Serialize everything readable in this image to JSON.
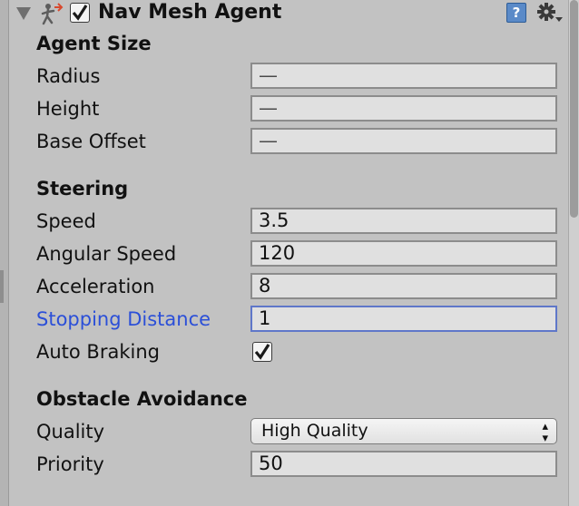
{
  "component": {
    "title": "Nav Mesh Agent",
    "enabled": true,
    "help_icon": "help-book-icon",
    "settings_icon": "gear-icon"
  },
  "sections": {
    "agent_size": {
      "title": "Agent Size",
      "radius": {
        "label": "Radius",
        "value": "—"
      },
      "height": {
        "label": "Height",
        "value": "—"
      },
      "base_offset": {
        "label": "Base Offset",
        "value": "—"
      }
    },
    "steering": {
      "title": "Steering",
      "speed": {
        "label": "Speed",
        "value": "3.5"
      },
      "angular_speed": {
        "label": "Angular Speed",
        "value": "120"
      },
      "acceleration": {
        "label": "Acceleration",
        "value": "8"
      },
      "stopping_distance": {
        "label": "Stopping Distance",
        "value": "1"
      },
      "auto_braking": {
        "label": "Auto Braking",
        "checked": true
      }
    },
    "obstacle_avoidance": {
      "title": "Obstacle Avoidance",
      "quality": {
        "label": "Quality",
        "value": "High Quality"
      },
      "priority": {
        "label": "Priority",
        "value": "50"
      }
    }
  },
  "colors": {
    "panel_bg": "#c2c2c2",
    "focus_label": "#2b4fd8"
  }
}
